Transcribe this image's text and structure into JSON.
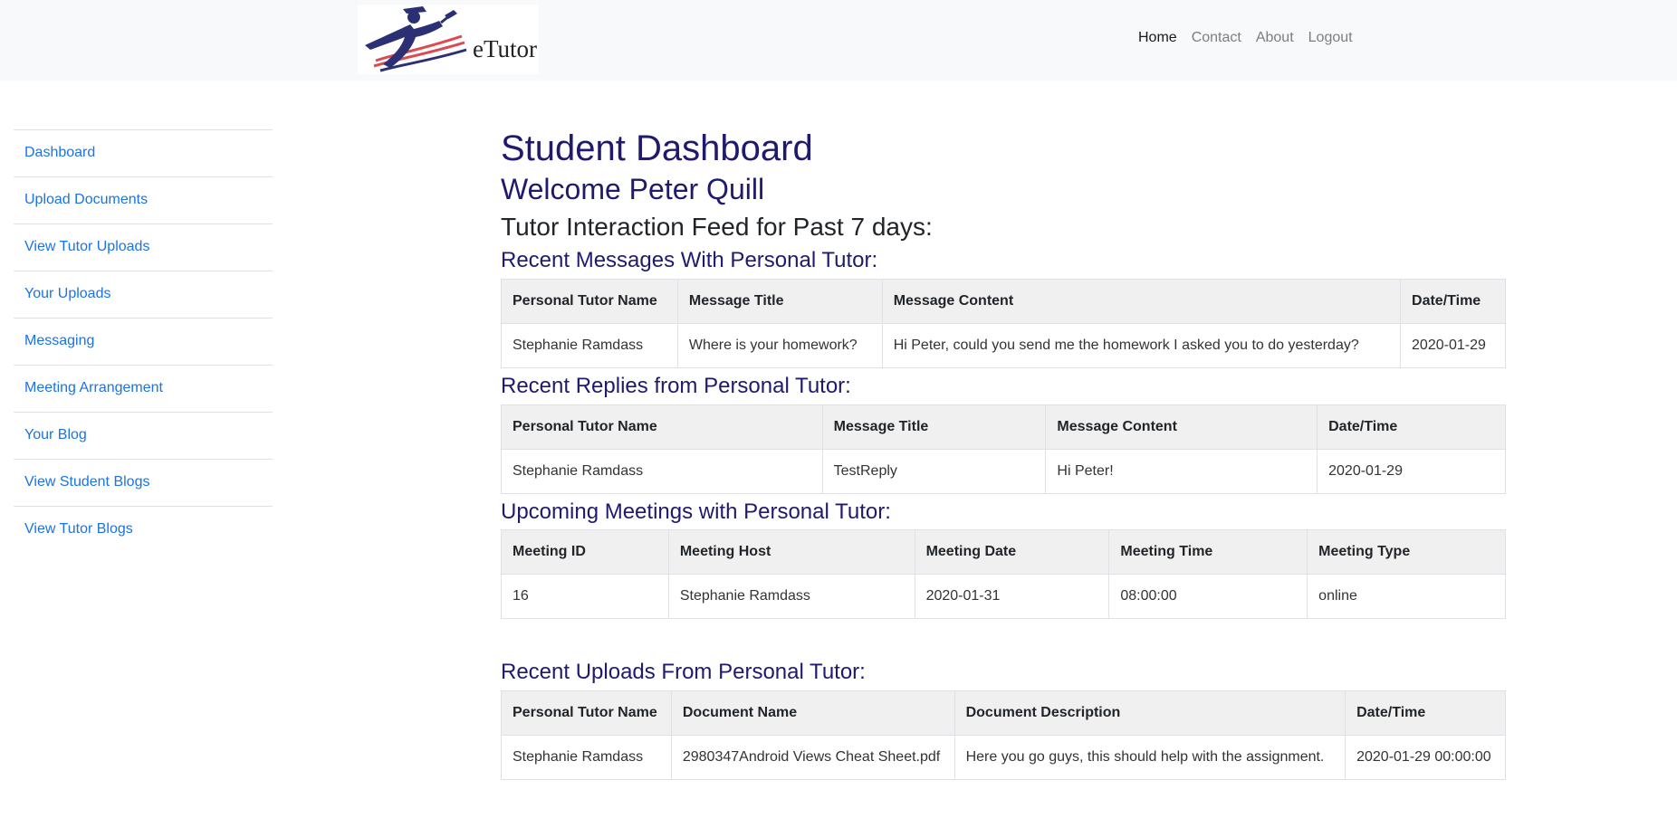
{
  "brand": {
    "logo_text": "eTutor"
  },
  "nav": [
    {
      "label": "Home",
      "active": true
    },
    {
      "label": "Contact",
      "active": false
    },
    {
      "label": "About",
      "active": false
    },
    {
      "label": "Logout",
      "active": false
    }
  ],
  "sidebar": {
    "items": [
      {
        "label": "Dashboard"
      },
      {
        "label": "Upload Documents"
      },
      {
        "label": "View Tutor Uploads"
      },
      {
        "label": "Your Uploads"
      },
      {
        "label": "Messaging"
      },
      {
        "label": "Meeting Arrangement"
      },
      {
        "label": "Your Blog"
      },
      {
        "label": "View Student Blogs"
      },
      {
        "label": "View Tutor Blogs"
      }
    ]
  },
  "main": {
    "title": "Student Dashboard",
    "welcome": "Welcome Peter Quill",
    "feed_title": "Tutor Interaction Feed for Past 7 days:",
    "messages": {
      "heading": "Recent Messages With Personal Tutor:",
      "columns": [
        "Personal Tutor Name",
        "Message Title",
        "Message Content",
        "Date/Time"
      ],
      "rows": [
        [
          "Stephanie Ramdass",
          "Where is your homework?",
          "Hi Peter, could you send me the homework I asked you to do yesterday?",
          "2020-01-29"
        ]
      ]
    },
    "replies": {
      "heading": "Recent Replies from Personal Tutor:",
      "columns": [
        "Personal Tutor Name",
        "Message Title",
        "Message Content",
        "Date/Time"
      ],
      "rows": [
        [
          "Stephanie Ramdass",
          "TestReply",
          "Hi Peter!",
          "2020-01-29"
        ]
      ]
    },
    "meetings": {
      "heading": "Upcoming Meetings with Personal Tutor:",
      "columns": [
        "Meeting ID",
        "Meeting Host",
        "Meeting Date",
        "Meeting Time",
        "Meeting Type"
      ],
      "rows": [
        [
          "16",
          "Stephanie Ramdass",
          "2020-01-31",
          "08:00:00",
          "online"
        ]
      ]
    },
    "uploads": {
      "heading": "Recent Uploads From Personal Tutor:",
      "columns": [
        "Personal Tutor Name",
        "Document Name",
        "Document Description",
        "Date/Time"
      ],
      "rows": [
        [
          "Stephanie Ramdass",
          "2980347Android Views Cheat Sheet.pdf",
          "Here you go guys, this should help with the assignment.",
          "2020-01-29 00:00:00"
        ]
      ]
    }
  }
}
